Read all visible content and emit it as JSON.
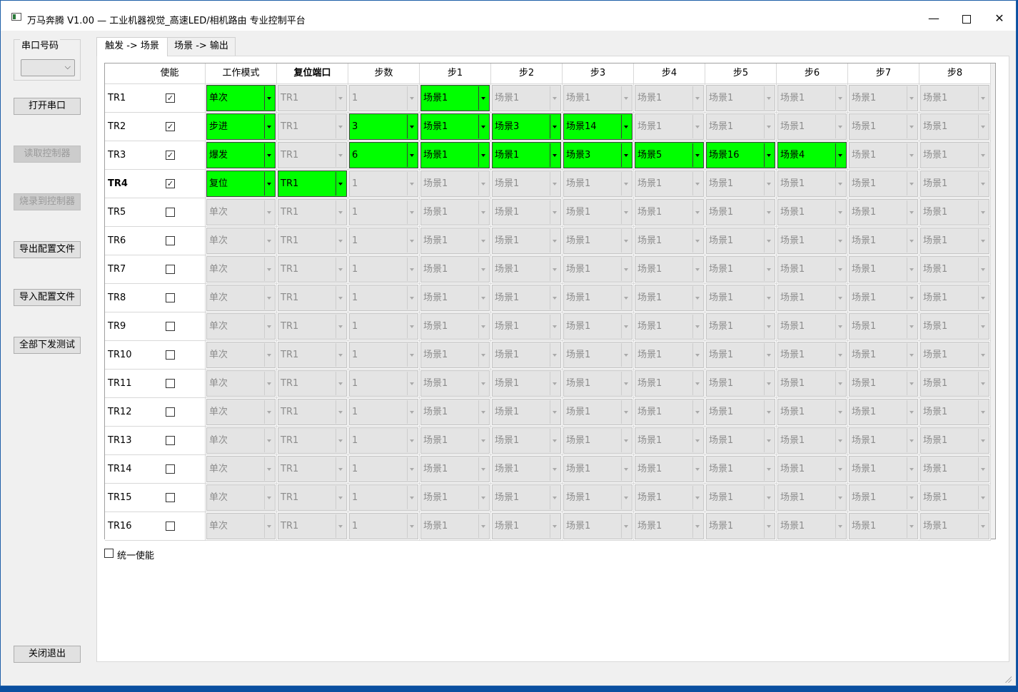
{
  "window": {
    "title": "万马奔腾 V1.00 — 工业机器视觉_高速LED/相机路由 专业控制平台",
    "min": "—",
    "close": "✕"
  },
  "sidebar": {
    "port_label": "串口号码",
    "port_value": "",
    "buttons": [
      {
        "label": "打开串口",
        "enabled": true
      },
      {
        "label": "读取控制器",
        "enabled": false
      },
      {
        "label": "烧录到控制器",
        "enabled": false
      },
      {
        "label": "导出配置文件",
        "enabled": true
      },
      {
        "label": "导入配置文件",
        "enabled": true
      },
      {
        "label": "全部下发测试",
        "enabled": true
      }
    ],
    "exit_label": "关闭退出"
  },
  "tabs": [
    {
      "label": "触发 -> 场景",
      "active": true
    },
    {
      "label": "场景 -> 输出",
      "active": false
    }
  ],
  "grid": {
    "headers": [
      "使能",
      "工作模式",
      "复位端口",
      "步数",
      "步1",
      "步2",
      "步3",
      "步4",
      "步5",
      "步6",
      "步7",
      "步8"
    ],
    "bold_header": "复位端口",
    "rows": [
      {
        "name": "TR1",
        "enabled": true,
        "bold": false,
        "cells": [
          "单次",
          "TR1",
          "1",
          "场景1",
          "场景1",
          "场景1",
          "场景1",
          "场景1",
          "场景1",
          "场景1",
          "场景1"
        ],
        "active": [
          0,
          3
        ]
      },
      {
        "name": "TR2",
        "enabled": true,
        "bold": false,
        "cells": [
          "步进",
          "TR1",
          "3",
          "场景1",
          "场景3",
          "场景14",
          "场景1",
          "场景1",
          "场景1",
          "场景1",
          "场景1"
        ],
        "active": [
          0,
          2,
          3,
          4,
          5
        ]
      },
      {
        "name": "TR3",
        "enabled": true,
        "bold": false,
        "cells": [
          "爆发",
          "TR1",
          "6",
          "场景1",
          "场景1",
          "场景3",
          "场景5",
          "场景16",
          "场景4",
          "场景1",
          "场景1"
        ],
        "active": [
          0,
          2,
          3,
          4,
          5,
          6,
          7,
          8
        ]
      },
      {
        "name": "TR4",
        "enabled": true,
        "bold": true,
        "cells": [
          "复位",
          "TR1",
          "1",
          "场景1",
          "场景1",
          "场景1",
          "场景1",
          "场景1",
          "场景1",
          "场景1",
          "场景1"
        ],
        "active": [
          0,
          1
        ]
      },
      {
        "name": "TR5",
        "enabled": false,
        "bold": false,
        "cells": [
          "单次",
          "TR1",
          "1",
          "场景1",
          "场景1",
          "场景1",
          "场景1",
          "场景1",
          "场景1",
          "场景1",
          "场景1"
        ],
        "active": []
      },
      {
        "name": "TR6",
        "enabled": false,
        "bold": false,
        "cells": [
          "单次",
          "TR1",
          "1",
          "场景1",
          "场景1",
          "场景1",
          "场景1",
          "场景1",
          "场景1",
          "场景1",
          "场景1"
        ],
        "active": []
      },
      {
        "name": "TR7",
        "enabled": false,
        "bold": false,
        "cells": [
          "单次",
          "TR1",
          "1",
          "场景1",
          "场景1",
          "场景1",
          "场景1",
          "场景1",
          "场景1",
          "场景1",
          "场景1"
        ],
        "active": []
      },
      {
        "name": "TR8",
        "enabled": false,
        "bold": false,
        "cells": [
          "单次",
          "TR1",
          "1",
          "场景1",
          "场景1",
          "场景1",
          "场景1",
          "场景1",
          "场景1",
          "场景1",
          "场景1"
        ],
        "active": []
      },
      {
        "name": "TR9",
        "enabled": false,
        "bold": false,
        "cells": [
          "单次",
          "TR1",
          "1",
          "场景1",
          "场景1",
          "场景1",
          "场景1",
          "场景1",
          "场景1",
          "场景1",
          "场景1"
        ],
        "active": []
      },
      {
        "name": "TR10",
        "enabled": false,
        "bold": false,
        "cells": [
          "单次",
          "TR1",
          "1",
          "场景1",
          "场景1",
          "场景1",
          "场景1",
          "场景1",
          "场景1",
          "场景1",
          "场景1"
        ],
        "active": []
      },
      {
        "name": "TR11",
        "enabled": false,
        "bold": false,
        "cells": [
          "单次",
          "TR1",
          "1",
          "场景1",
          "场景1",
          "场景1",
          "场景1",
          "场景1",
          "场景1",
          "场景1",
          "场景1"
        ],
        "active": []
      },
      {
        "name": "TR12",
        "enabled": false,
        "bold": false,
        "cells": [
          "单次",
          "TR1",
          "1",
          "场景1",
          "场景1",
          "场景1",
          "场景1",
          "场景1",
          "场景1",
          "场景1",
          "场景1"
        ],
        "active": []
      },
      {
        "name": "TR13",
        "enabled": false,
        "bold": false,
        "cells": [
          "单次",
          "TR1",
          "1",
          "场景1",
          "场景1",
          "场景1",
          "场景1",
          "场景1",
          "场景1",
          "场景1",
          "场景1"
        ],
        "active": []
      },
      {
        "name": "TR14",
        "enabled": false,
        "bold": false,
        "cells": [
          "单次",
          "TR1",
          "1",
          "场景1",
          "场景1",
          "场景1",
          "场景1",
          "场景1",
          "场景1",
          "场景1",
          "场景1"
        ],
        "active": []
      },
      {
        "name": "TR15",
        "enabled": false,
        "bold": false,
        "cells": [
          "单次",
          "TR1",
          "1",
          "场景1",
          "场景1",
          "场景1",
          "场景1",
          "场景1",
          "场景1",
          "场景1",
          "场景1"
        ],
        "active": []
      },
      {
        "name": "TR16",
        "enabled": false,
        "bold": false,
        "cells": [
          "单次",
          "TR1",
          "1",
          "场景1",
          "场景1",
          "场景1",
          "场景1",
          "场景1",
          "场景1",
          "场景1",
          "场景1"
        ],
        "active": []
      }
    ]
  },
  "unify_enable": {
    "label": "统一使能",
    "checked": false
  },
  "colors": {
    "active_cell": "#00ff00",
    "disabled_cell": "#e4e4e4"
  }
}
